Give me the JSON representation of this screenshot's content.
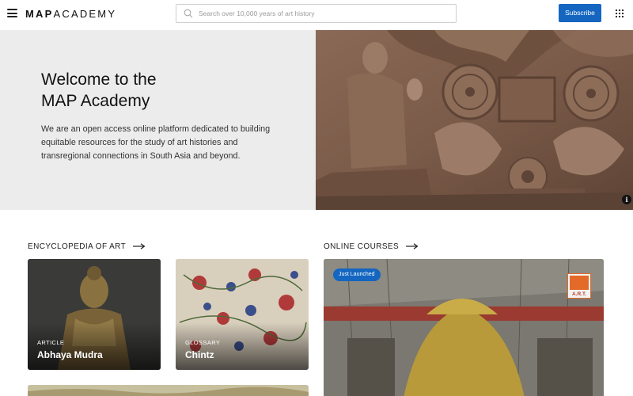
{
  "header": {
    "logo_bold": "MAP",
    "logo_light": "ACADEMY",
    "search_placeholder": "Search over 10,000 years of art history",
    "subscribe_label": "Subscribe"
  },
  "hero": {
    "title_line1": "Welcome to the",
    "title_line2": "MAP Academy",
    "description": "We are an open access online platform dedicated to building equitable resources for the study of art histories and transregional connections in South Asia and beyond.",
    "info_label": "i"
  },
  "sections": {
    "encyclopedia": {
      "heading": "ENCYCLOPEDIA OF ART",
      "cards": [
        {
          "type": "ARTICLE",
          "title": "Abhaya Mudra"
        },
        {
          "type": "GLOSSARY",
          "title": "Chintz"
        }
      ]
    },
    "courses": {
      "heading": "ONLINE COURSES",
      "badge": "Just Launched",
      "logo_text": "A.R.T."
    }
  },
  "colors": {
    "accent": "#1466c0",
    "hero_bg": "#ececec"
  }
}
